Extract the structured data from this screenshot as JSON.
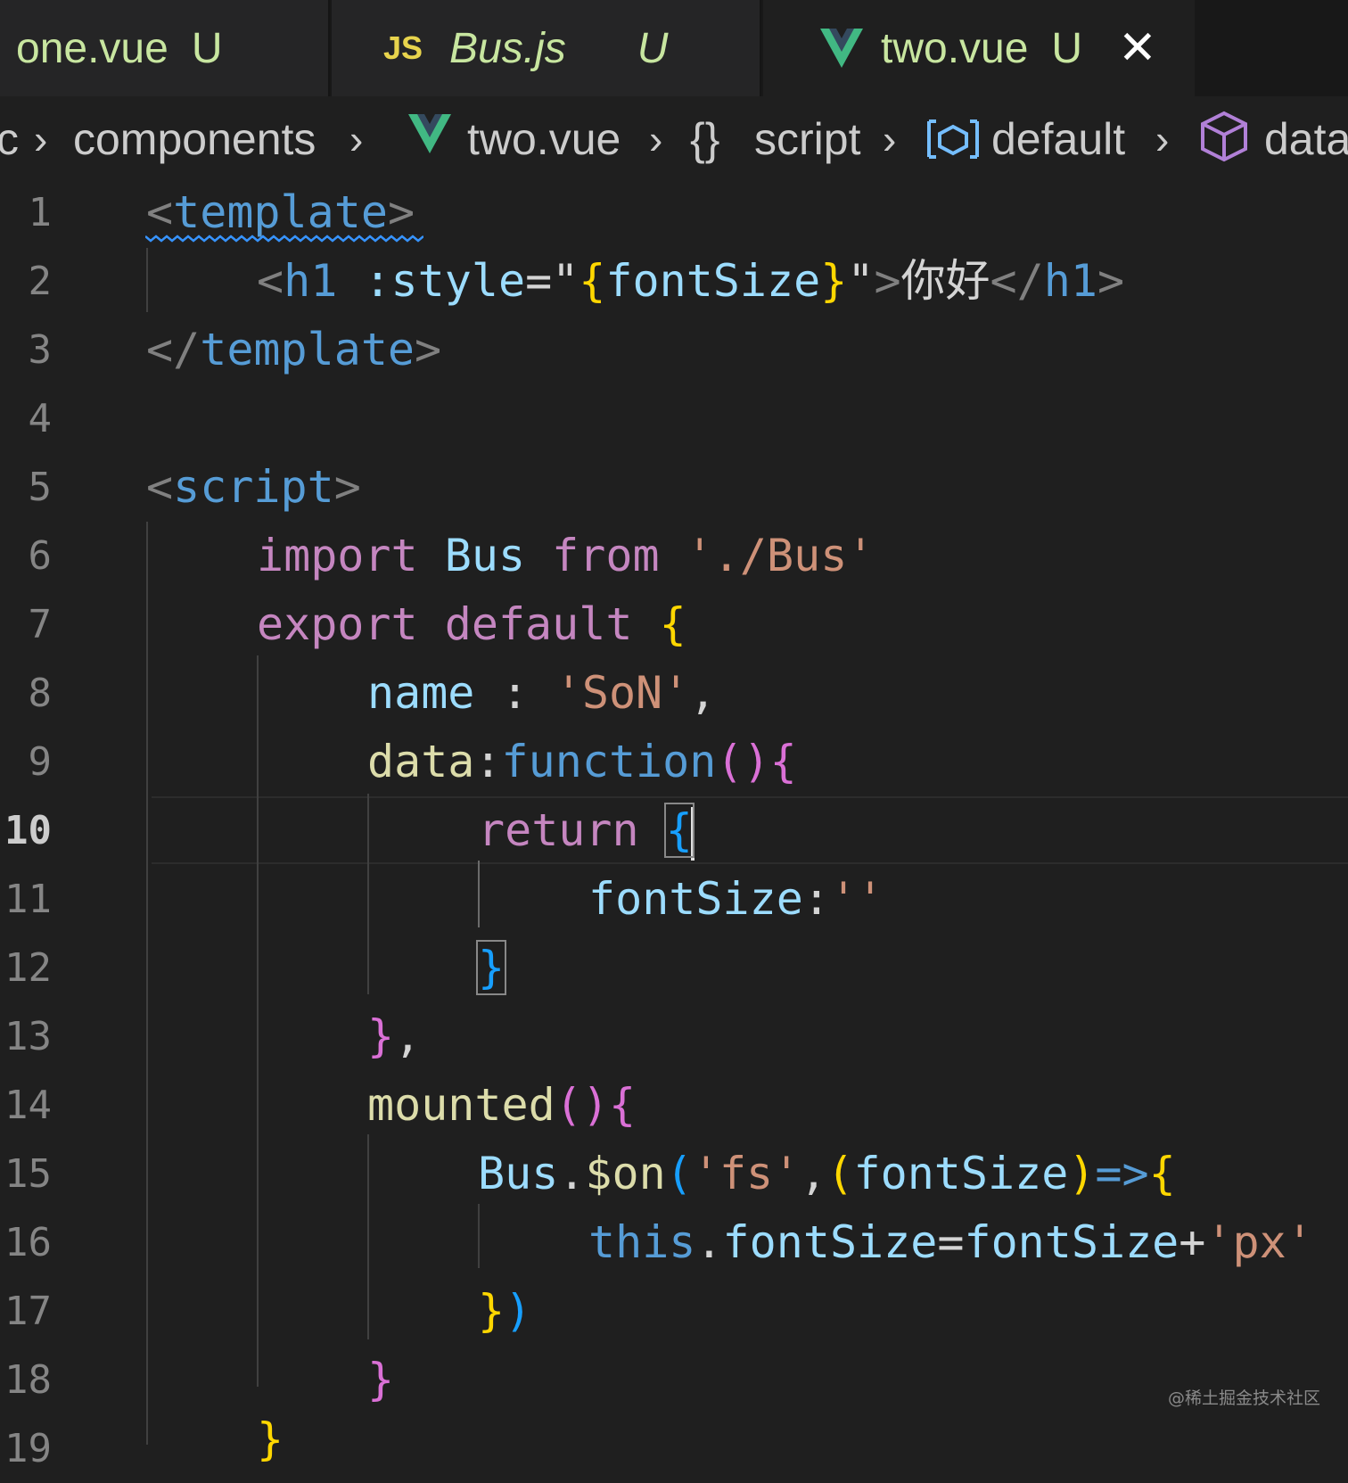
{
  "tabs": [
    {
      "name": "one.vue",
      "status": "U",
      "icon": "vue-icon"
    },
    {
      "name": "Bus.js",
      "status": "U",
      "icon": "js-icon",
      "icon_text": "JS"
    },
    {
      "name": "two.vue",
      "status": "U",
      "icon": "vue-icon",
      "active": true,
      "close": "✕"
    }
  ],
  "breadcrumb": {
    "items": [
      "c",
      "components",
      "two.vue",
      "script",
      "default",
      "data"
    ],
    "separator": "›",
    "braces_glyph": "{}"
  },
  "editor": {
    "line_numbers": [
      "1",
      "2",
      "3",
      "4",
      "5",
      "6",
      "7",
      "8",
      "9",
      "10",
      "11",
      "12",
      "13",
      "14",
      "15",
      "16",
      "17",
      "18",
      "19"
    ],
    "current_line": "10",
    "lines": {
      "l1": {
        "lt": "<",
        "name": "template",
        "gt": ">"
      },
      "l2": {
        "lt": "<",
        "name": "h1",
        "attr": ":style",
        "eq": "=\"",
        "b_open": "{",
        "var": "fontSize",
        "b_close": "}",
        "q": "\"",
        "gt": ">",
        "text": "你好",
        "close_lt": "</",
        "close_name": "h1",
        "close_gt": ">"
      },
      "l3": {
        "lt": "</",
        "name": "template",
        "gt": ">"
      },
      "l5": {
        "lt": "<",
        "name": "script",
        "gt": ">"
      },
      "l6": {
        "kw": "import",
        "id": "Bus",
        "from": "from",
        "str": "'./Bus'"
      },
      "l7": {
        "kw": "export",
        "def": "default",
        "b": "{"
      },
      "l8": {
        "prop": "name",
        "colon": " : ",
        "str": "'SoN'",
        "comma": ","
      },
      "l9": {
        "prop": "data",
        "colon": ":",
        "fn": "function",
        "paren": "()",
        "b": "{"
      },
      "l10": {
        "kw": "return",
        "b": "{"
      },
      "l11": {
        "prop": "fontSize",
        "colon": ":",
        "str": "''"
      },
      "l12": {
        "b": "}"
      },
      "l13": {
        "b": "}",
        "comma": ","
      },
      "l14": {
        "fn": "mounted",
        "paren": "()",
        "b": "{"
      },
      "l15": {
        "obj": "Bus",
        "dot": ".",
        "fn": "$on",
        "p_open": "(",
        "str": "'fs'",
        "comma": ",",
        "p2_open": "(",
        "param": "fontSize",
        "p2_close": ")",
        "arrow": "=>",
        "b": "{"
      },
      "l16": {
        "this": "this",
        "dot": ".",
        "prop": "fontSize",
        "eq": "=",
        "param": "fontSize",
        "plus": "+",
        "str": "'px'"
      },
      "l17": {
        "b": "}",
        "p": ")"
      },
      "l18": {
        "b": "}"
      },
      "l19": {
        "b": "}"
      }
    }
  },
  "watermark": "@稀土掘金技术社区",
  "colors": {
    "background": "#1f1f1f",
    "tab_text": "#c8e6a0",
    "vue_green": "#41b883",
    "keyword": "#c586c0",
    "string": "#ce9178",
    "tag": "#569cd6"
  }
}
